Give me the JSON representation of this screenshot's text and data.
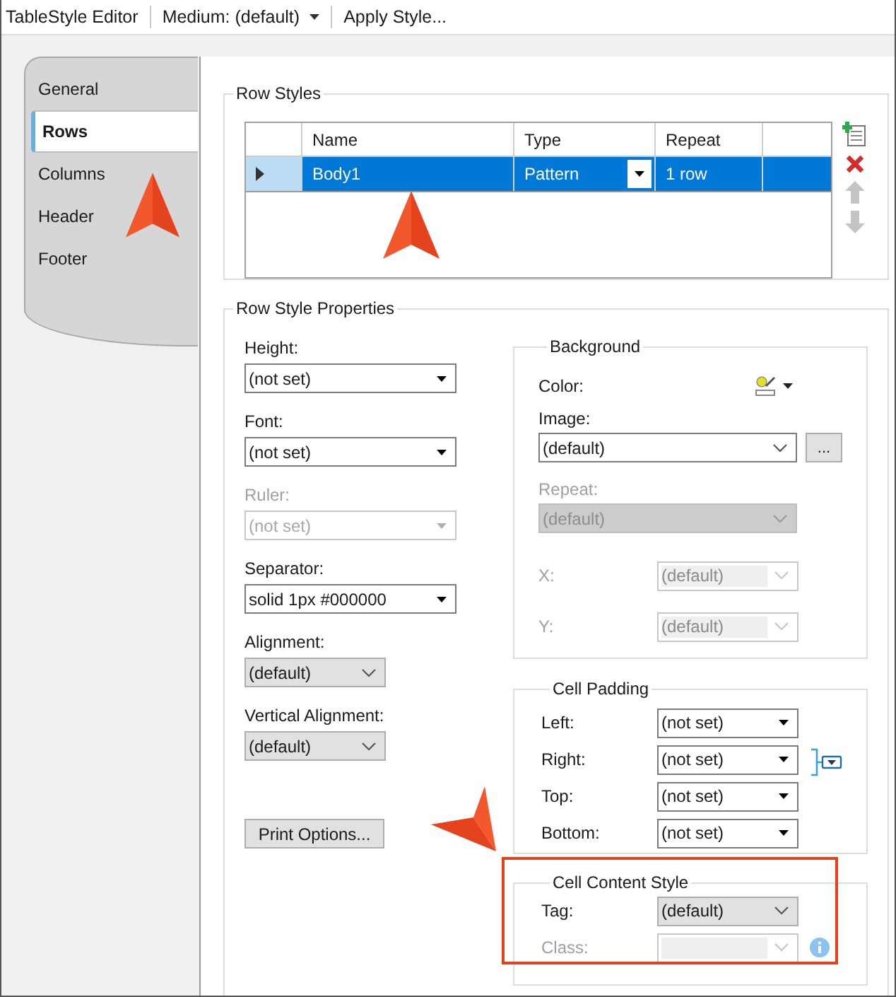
{
  "toolbar": {
    "title": "TableStyle Editor",
    "medium": "Medium: (default)",
    "apply": "Apply Style..."
  },
  "tabs": [
    {
      "label": "General",
      "selected": false
    },
    {
      "label": "Rows",
      "selected": true
    },
    {
      "label": "Columns",
      "selected": false
    },
    {
      "label": "Header",
      "selected": false
    },
    {
      "label": "Footer",
      "selected": false
    }
  ],
  "row_styles": {
    "title": "Row Styles",
    "columns": [
      "Name",
      "Type",
      "Repeat"
    ],
    "rows": [
      {
        "name": "Body1",
        "type": "Pattern",
        "repeat": "1 row",
        "selected": true
      }
    ]
  },
  "row_style_properties": {
    "title": "Row Style Properties",
    "fields": [
      {
        "label": "Height:",
        "value": "(not set)",
        "kind": "list",
        "disabled": false
      },
      {
        "label": "Font:",
        "value": "(not set)",
        "kind": "list",
        "disabled": false
      },
      {
        "label": "Ruler:",
        "value": "(not set)",
        "kind": "list",
        "disabled": true
      },
      {
        "label": "Separator:",
        "value": "solid 1px #000000",
        "kind": "list",
        "disabled": false
      },
      {
        "label": "Alignment:",
        "value": "(default)",
        "kind": "select",
        "disabled": false
      },
      {
        "label": "Vertical Alignment:",
        "value": "(default)",
        "kind": "select",
        "disabled": false
      }
    ],
    "print_button": "Print Options..."
  },
  "background": {
    "title": "Background",
    "color_label": "Color:",
    "fields": [
      {
        "label": "Image:",
        "value": "(default)",
        "kind": "text-select",
        "disabled": false,
        "browse": "..."
      },
      {
        "label": "Repeat:",
        "value": "(default)",
        "kind": "select",
        "disabled": true
      }
    ],
    "offsets": [
      {
        "label": "X:",
        "value": "(default)",
        "kind": "combo",
        "disabled": true
      },
      {
        "label": "Y:",
        "value": "(default)",
        "kind": "combo",
        "disabled": true
      }
    ]
  },
  "cell_padding": {
    "title": "Cell Padding",
    "fields": [
      {
        "label": "Left:",
        "value": "(not set)",
        "kind": "list",
        "disabled": false
      },
      {
        "label": "Right:",
        "value": "(not set)",
        "kind": "list",
        "disabled": false
      },
      {
        "label": "Top:",
        "value": "(not set)",
        "kind": "list",
        "disabled": false
      },
      {
        "label": "Bottom:",
        "value": "(not set)",
        "kind": "list",
        "disabled": false
      }
    ]
  },
  "cell_content_style": {
    "title": "Cell Content Style",
    "highlighted": true,
    "fields": [
      {
        "label": "Tag:",
        "value": "(default)",
        "kind": "select",
        "disabled": false
      },
      {
        "label": "Class:",
        "kind": "combo",
        "disabled": true
      }
    ]
  }
}
